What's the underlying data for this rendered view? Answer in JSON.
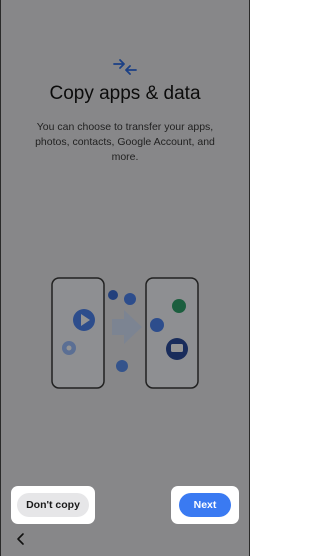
{
  "page": {
    "title": "Copy apps & data",
    "subtitle": "You can choose to transfer your apps, photos, contacts, Google Account, and more."
  },
  "buttons": {
    "dont_copy_label": "Don't copy",
    "next_label": "Next"
  },
  "icons": {
    "header": "transfer-arrows-icon",
    "back": "back-chevron-icon",
    "illustration": "phone-to-phone-transfer-illustration"
  },
  "colors": {
    "accent": "#3a7af2",
    "background": "#e9e9ec",
    "overlay": "rgba(0,0,0,0.42)"
  }
}
